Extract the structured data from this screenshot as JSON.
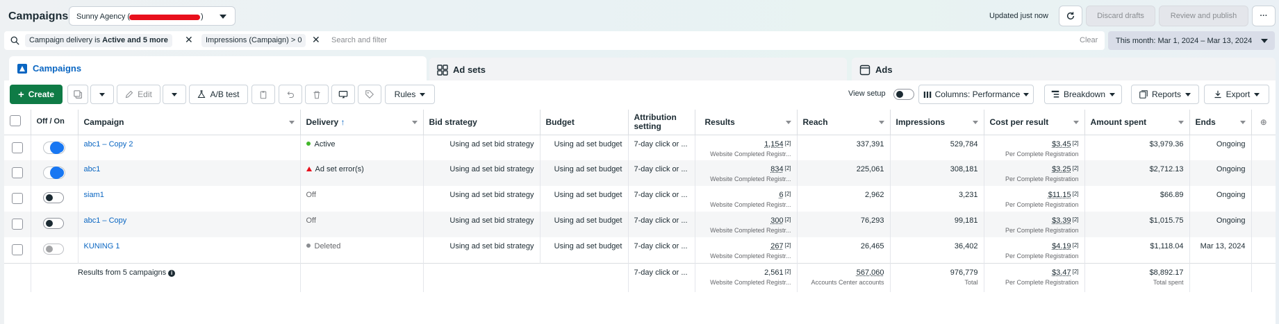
{
  "header": {
    "title": "Campaigns",
    "account_name": "Sunny Agency (",
    "account_suffix": ")",
    "updated": "Updated just now",
    "discard": "Discard drafts",
    "review": "Review and publish",
    "more": "···"
  },
  "filters": {
    "chip1_prefix": "Campaign delivery is ",
    "chip1_bold": "Active and 5 more",
    "chip2": "Impressions (Campaign) > 0",
    "search_placeholder": "Search and filter",
    "clear": "Clear",
    "date_range": "This month: Mar 1, 2024 – Mar 13, 2024"
  },
  "tabs": [
    {
      "label": "Campaigns"
    },
    {
      "label": "Ad sets"
    },
    {
      "label": "Ads"
    }
  ],
  "toolbar": {
    "create": "Create",
    "edit": "Edit",
    "ab_test": "A/B test",
    "rules": "Rules",
    "view_setup": "View setup",
    "columns": "Columns: Performance",
    "breakdown": "Breakdown",
    "reports": "Reports",
    "export": "Export"
  },
  "table": {
    "headers": {
      "offon": "Off / On",
      "campaign": "Campaign",
      "delivery": "Delivery",
      "bid": "Bid strategy",
      "budget": "Budget",
      "attribution": "Attribution setting",
      "results": "Results",
      "reach": "Reach",
      "impressions": "Impressions",
      "cpr": "Cost per result",
      "spent": "Amount spent",
      "ends": "Ends"
    },
    "rows": [
      {
        "name": "abc1 – Copy 2",
        "delivery": "Active",
        "bid": "Using ad set bid strategy",
        "budget": "Using ad set budget",
        "attribution": "7-day click or ...",
        "results": "1,154",
        "results_sub": "Website Completed Registr...",
        "reach": "337,391",
        "impressions": "529,784",
        "cpr": "$3.45",
        "cpr_sub": "Per Complete Registration",
        "spent": "$3,979.36",
        "ends": "Ongoing"
      },
      {
        "name": "abc1",
        "delivery": "Ad set error(s)",
        "bid": "Using ad set bid strategy",
        "budget": "Using ad set budget",
        "attribution": "7-day click or ...",
        "results": "834",
        "results_sub": "Website Completed Registr...",
        "reach": "225,061",
        "impressions": "308,181",
        "cpr": "$3.25",
        "cpr_sub": "Per Complete Registration",
        "spent": "$2,712.13",
        "ends": "Ongoing"
      },
      {
        "name": "siam1",
        "delivery": "Off",
        "bid": "Using ad set bid strategy",
        "budget": "Using ad set budget",
        "attribution": "7-day click or ...",
        "results": "6",
        "results_sub": "Website Completed Registr...",
        "reach": "2,962",
        "impressions": "3,231",
        "cpr": "$11.15",
        "cpr_sub": "Per Complete Registration",
        "spent": "$66.89",
        "ends": "Ongoing"
      },
      {
        "name": "abc1 – Copy",
        "delivery": "Off",
        "bid": "Using ad set bid strategy",
        "budget": "Using ad set budget",
        "attribution": "7-day click or ...",
        "results": "300",
        "results_sub": "Website Completed Registr...",
        "reach": "76,293",
        "impressions": "99,181",
        "cpr": "$3.39",
        "cpr_sub": "Per Complete Registration",
        "spent": "$1,015.75",
        "ends": "Ongoing"
      },
      {
        "name": "KUNING 1",
        "delivery": "Deleted",
        "bid": "Using ad set bid strategy",
        "budget": "Using ad set budget",
        "attribution": "7-day click or ...",
        "results": "267",
        "results_sub": "Website Completed Registr...",
        "reach": "26,465",
        "impressions": "36,402",
        "cpr": "$4.19",
        "cpr_sub": "Per Complete Registration",
        "spent": "$1,118.04",
        "ends": "Mar 13, 2024"
      }
    ],
    "summary": {
      "label": "Results from 5 campaigns",
      "attribution": "7-day click or ...",
      "results": "2,561",
      "results_sub": "Website Completed Registr...",
      "reach": "567,060",
      "reach_sub": "Accounts Center accounts",
      "impressions": "976,779",
      "impressions_sub": "Total",
      "cpr": "$3.47",
      "cpr_sub": "Per Complete Registration",
      "spent": "$8,892.17",
      "spent_sub": "Total spent"
    },
    "footnote_mark": "[2]"
  },
  "colors": {
    "green": "#0f7b46",
    "blue": "#1877f2",
    "active_dot": "#42b72a",
    "error": "#e8101c",
    "deleted_dot": "#8a8d91"
  }
}
